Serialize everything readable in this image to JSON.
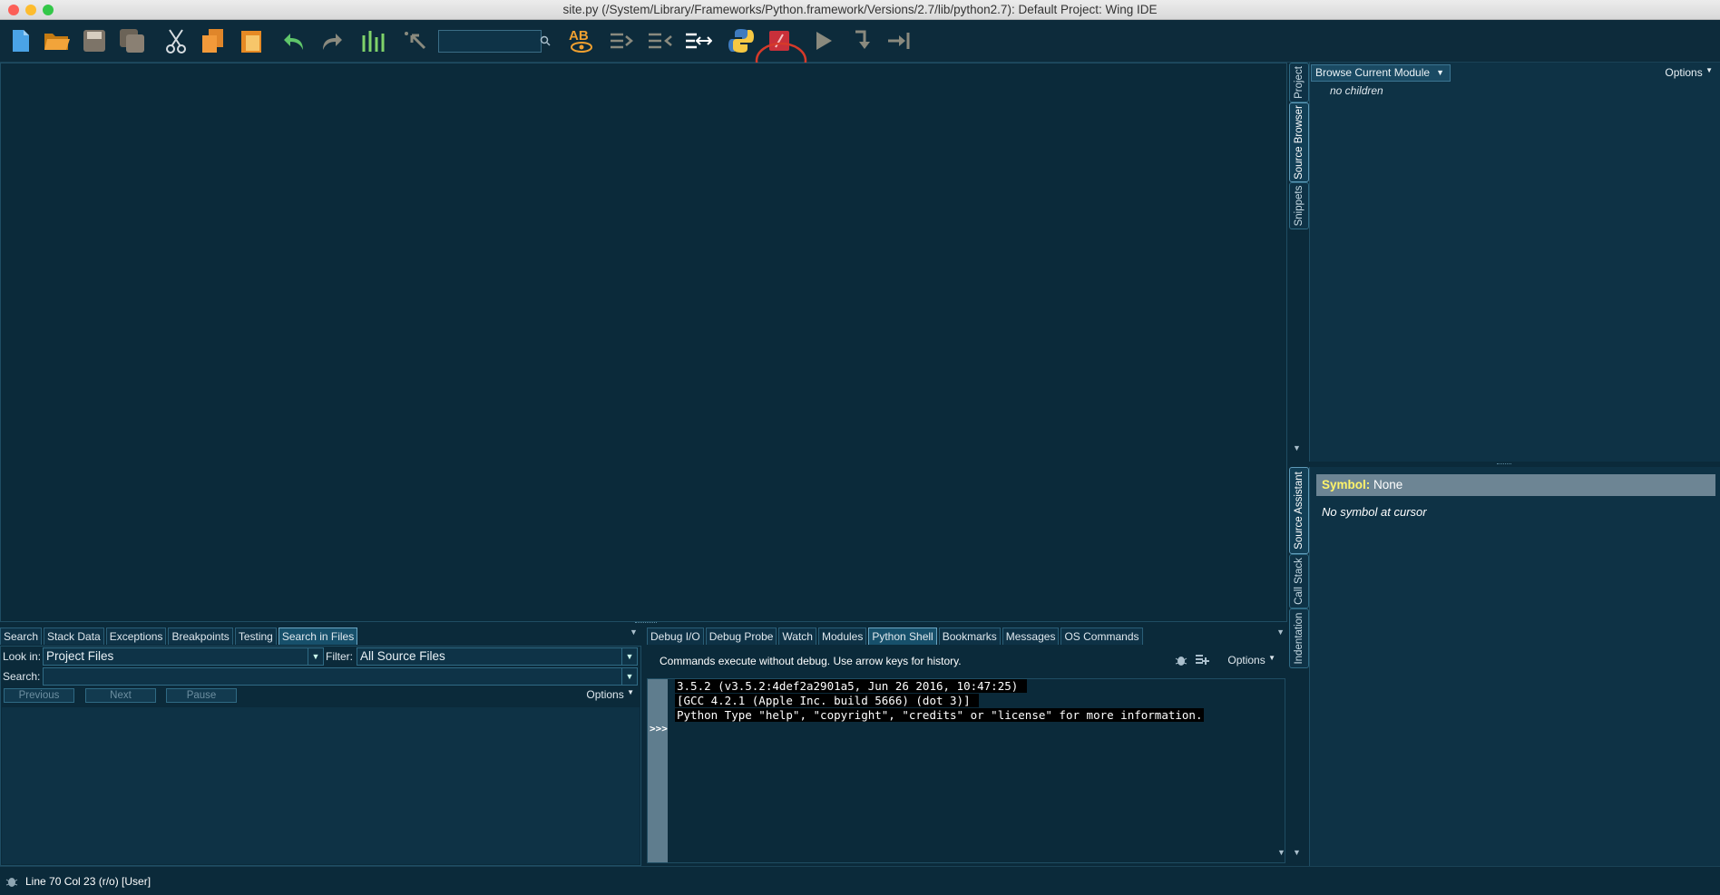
{
  "window": {
    "title": "site.py (/System/Library/Frameworks/Python.framework/Versions/2.7/lib/python2.7): Default Project: Wing IDE",
    "traffic_colors": [
      "#fc5f57",
      "#fdbc2e",
      "#33c748"
    ]
  },
  "toolbar": {
    "search_value": "",
    "icons": [
      "new-file-icon",
      "open-file-icon",
      "save-icon",
      "save-all-icon",
      "cut-icon",
      "copy-icon",
      "paste-icon",
      "undo-icon",
      "redo-icon",
      "indent-to-match-icon",
      "select-icon",
      "search-icon",
      "spell-check-icon",
      "indent-icon",
      "outdent-icon",
      "reformat-icon",
      "python-icon",
      "debug-icon",
      "run-icon",
      "step-into-icon",
      "step-out-icon"
    ],
    "highlight_color": "#d63a2a"
  },
  "right_panel": {
    "side_tabs": [
      "Project",
      "Source Browser",
      "Snippets",
      "Source Assistant",
      "Call Stack",
      "Indentation"
    ],
    "browser": {
      "dropdown": "Browse Current Module",
      "options_label": "Options",
      "empty_text": "no children"
    },
    "assistant": {
      "symbol_label": "Symbol:",
      "symbol_value": "None",
      "no_symbol_text": "No symbol at cursor"
    }
  },
  "bottom_left": {
    "tabs": [
      "Search",
      "Stack Data",
      "Exceptions",
      "Breakpoints",
      "Testing",
      "Search in Files"
    ],
    "active_tab": "Search in Files",
    "look_in_label": "Look in:",
    "look_in_value": "Project Files",
    "filter_label": "Filter:",
    "filter_value": "All Source Files",
    "search_label": "Search:",
    "search_value": "",
    "previous_label": "Previous",
    "next_label": "Next",
    "pause_label": "Pause",
    "options_label": "Options"
  },
  "bottom_right": {
    "tabs": [
      "Debug I/O",
      "Debug Probe",
      "Watch",
      "Modules",
      "Python Shell",
      "Bookmarks",
      "Messages",
      "OS Commands"
    ],
    "active_tab": "Python Shell",
    "hint": "Commands execute without debug.  Use arrow keys for history.",
    "options_label": "Options",
    "prompt": ">>>",
    "lines": [
      "3.5.2 (v3.5.2:4def2a2901a5, Jun 26 2016, 10:47:25) ",
      "[GCC 4.2.1 (Apple Inc. build 5666) (dot 3)] ",
      "Python Type \"help\", \"copyright\", \"credits\" or \"license\" for more information."
    ]
  },
  "status": {
    "text": "Line 70 Col 23 (r/o) [User]"
  }
}
